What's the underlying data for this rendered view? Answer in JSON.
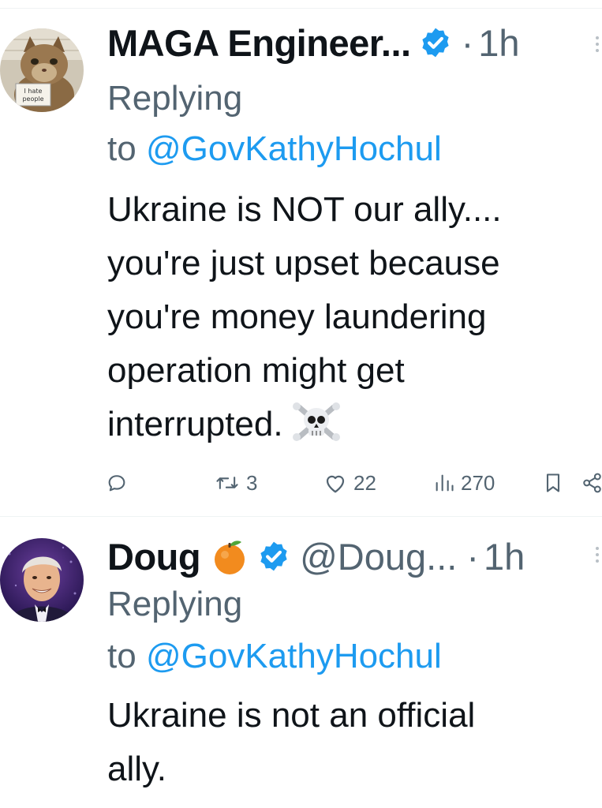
{
  "tweets": [
    {
      "author_name": "MAGA Engineer...",
      "verified": true,
      "separator": "·",
      "time": "1h",
      "replying_prefix": "Replying",
      "replying_to_word": "to",
      "replying_handle": "@GovKathyHochul",
      "body": "Ukraine is NOT our ally....\nyou're just upset because\nyou're money laundering\noperation might get\ninterrupted.",
      "body_emoji": "skull-and-crossbones",
      "avatar_sign_text": "I hate people",
      "actions": {
        "reply_count": "",
        "retweet_count": "3",
        "like_count": "22",
        "view_count": "270"
      }
    },
    {
      "author_name": "Doug",
      "name_emoji": "tangerine",
      "verified": true,
      "handle": "@Doug...",
      "separator": "·",
      "time": "1h",
      "replying_prefix": "Replying",
      "replying_to_word": "to",
      "replying_handle": "@GovKathyHochul",
      "body": "Ukraine is not an official\nally."
    }
  ],
  "colors": {
    "text_primary": "#0f1419",
    "text_secondary": "#536471",
    "accent": "#1d9bf0",
    "divider": "#eff3f4"
  },
  "icons": [
    "verified-badge-icon",
    "reply-icon",
    "retweet-icon",
    "like-icon",
    "views-icon",
    "bookmark-icon",
    "share-icon",
    "more-icon"
  ]
}
